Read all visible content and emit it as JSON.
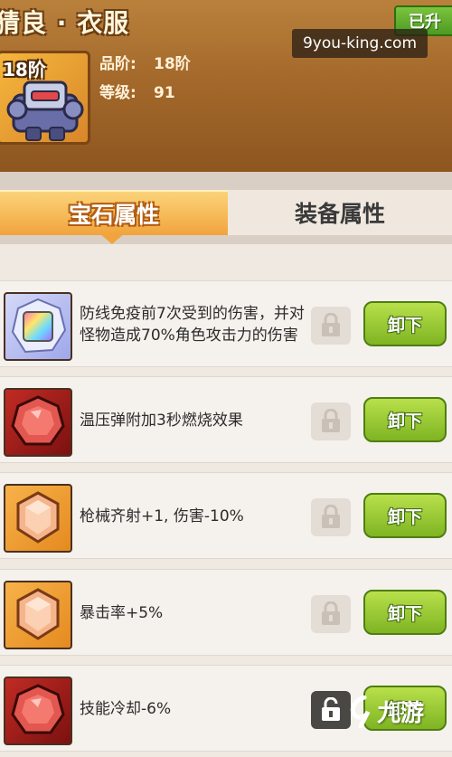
{
  "header": {
    "title": "猜良 · 衣服",
    "badge": "已升",
    "tier": "18阶",
    "stats": [
      {
        "label": "品阶:",
        "value": "18阶"
      },
      {
        "label": "等级:",
        "value": "91"
      }
    ]
  },
  "watermark": "9you-king.com",
  "tabs": [
    {
      "label": "宝石属性",
      "active": true
    },
    {
      "label": "装备属性",
      "active": false
    }
  ],
  "gems": [
    {
      "icon": "rainbow-gem-icon",
      "color": "rainbow",
      "desc": "防线免疫前7次受到的伤害，并对怪物造成70%角色攻击力的伤害",
      "button": "卸下",
      "locked": false
    },
    {
      "icon": "red-gem-icon",
      "color": "red",
      "desc": "温压弹附加3秒燃烧效果",
      "button": "卸下",
      "locked": false
    },
    {
      "icon": "orange-gem-icon",
      "color": "orange",
      "desc": "枪械齐射+1, 伤害-10%",
      "button": "卸下",
      "locked": false
    },
    {
      "icon": "orange-gem-icon",
      "color": "orange",
      "desc": "暴击率+5%",
      "button": "卸下",
      "locked": false
    },
    {
      "icon": "red-gem-icon",
      "color": "red",
      "desc": "技能冷却-6%",
      "button": "卸下",
      "locked": true
    }
  ],
  "logo": {
    "text": "九游"
  },
  "colors": {
    "accent": "#f1a43c",
    "button": "#8fc22a",
    "header": "#a4692b"
  }
}
